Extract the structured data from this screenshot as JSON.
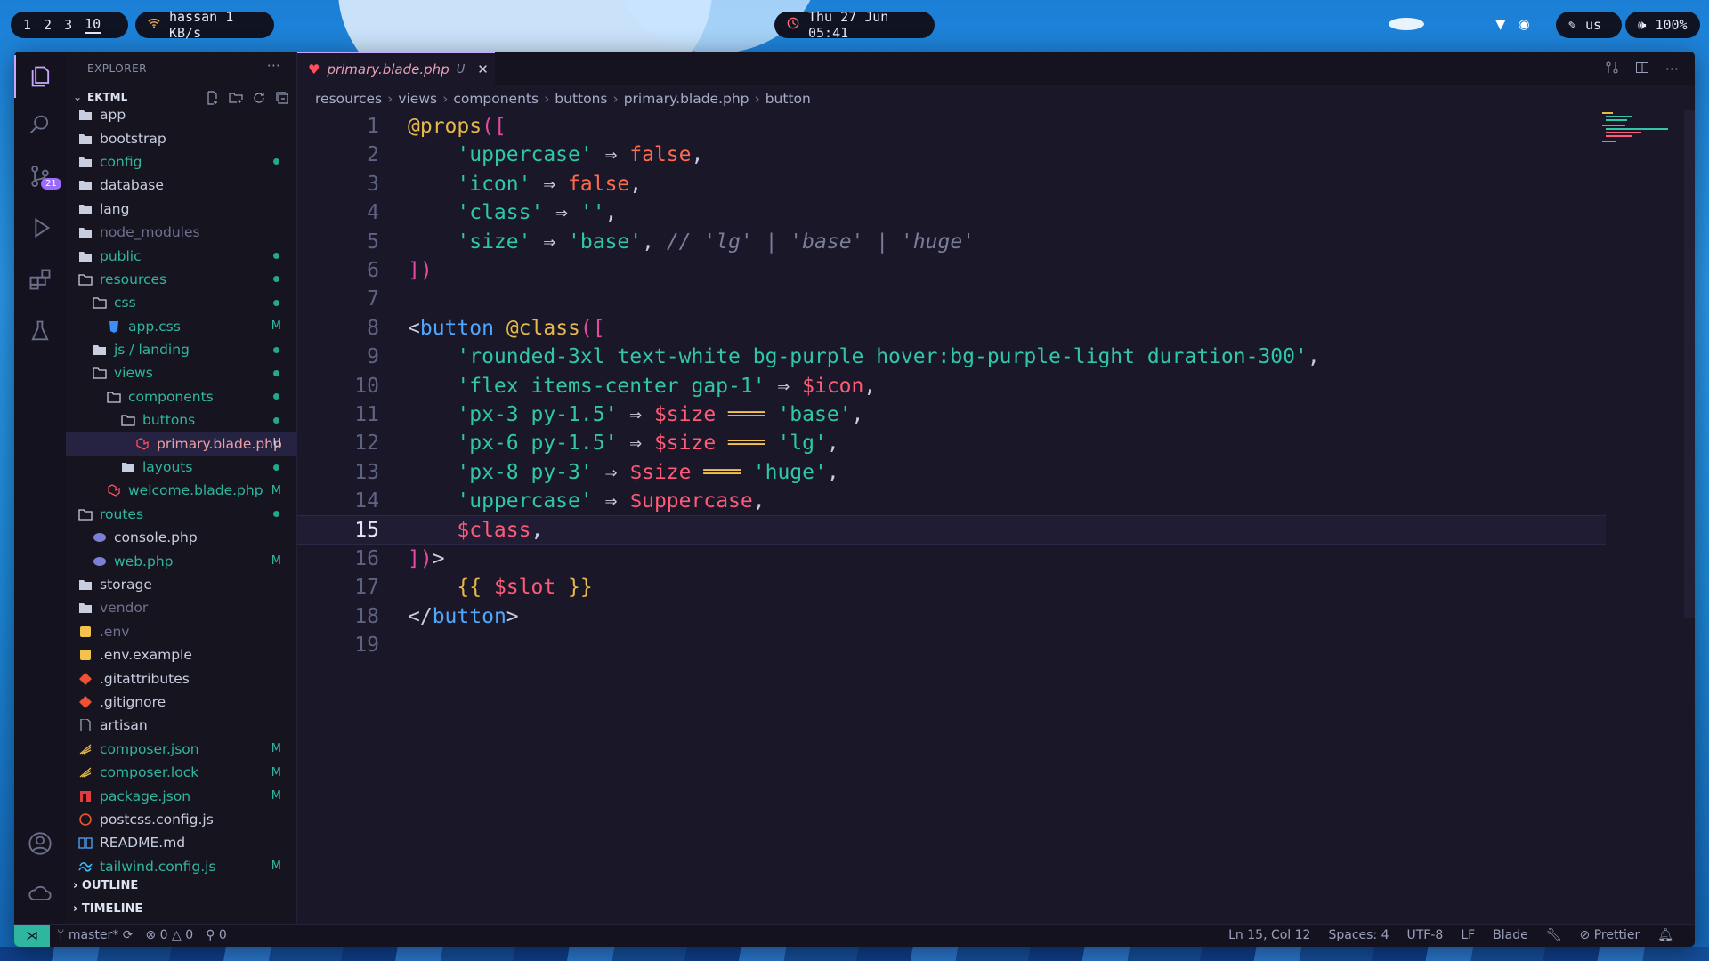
{
  "topbar": {
    "workspaces": [
      "1",
      "2",
      "3",
      "10"
    ],
    "network": "hassan 1 KB/s",
    "clock": "Thu 27 Jun 05:41",
    "keyboard": "us",
    "volume": "100%"
  },
  "explorer": {
    "title": "EXPLORER",
    "project": "EKTML",
    "tree": [
      {
        "label": "app",
        "icon": "folder-icon",
        "indent": 0,
        "status": "",
        "kind": "norm"
      },
      {
        "label": "bootstrap",
        "icon": "folder-icon",
        "indent": 0,
        "status": "",
        "kind": "norm"
      },
      {
        "label": "config",
        "icon": "folder-icon",
        "indent": 0,
        "status": "dot",
        "kind": "mod"
      },
      {
        "label": "database",
        "icon": "folder-icon",
        "indent": 0,
        "status": "",
        "kind": "norm"
      },
      {
        "label": "lang",
        "icon": "folder-icon",
        "indent": 0,
        "status": "",
        "kind": "norm"
      },
      {
        "label": "node_modules",
        "icon": "folder-icon",
        "indent": 0,
        "status": "",
        "kind": "dim"
      },
      {
        "label": "public",
        "icon": "folder-icon",
        "indent": 0,
        "status": "dot",
        "kind": "mod"
      },
      {
        "label": "resources",
        "icon": "folder-open-icon",
        "indent": 0,
        "status": "dot",
        "kind": "mod"
      },
      {
        "label": "css",
        "icon": "folder-open-icon",
        "indent": 1,
        "status": "dot",
        "kind": "mod"
      },
      {
        "label": "app.css",
        "icon": "css-file-icon",
        "indent": 2,
        "status": "M",
        "kind": "mod"
      },
      {
        "label": "js / landing",
        "icon": "folder-icon",
        "indent": 1,
        "status": "dot",
        "kind": "mod"
      },
      {
        "label": "views",
        "icon": "folder-open-icon",
        "indent": 1,
        "status": "dot",
        "kind": "mod"
      },
      {
        "label": "components",
        "icon": "folder-open-icon",
        "indent": 2,
        "status": "dot",
        "kind": "mod"
      },
      {
        "label": "buttons",
        "icon": "folder-open-icon",
        "indent": 3,
        "status": "dot",
        "kind": "mod"
      },
      {
        "label": "primary.blade.php",
        "icon": "blade-file-icon",
        "indent": 4,
        "status": "U",
        "kind": "sel"
      },
      {
        "label": "layouts",
        "icon": "folder-icon",
        "indent": 3,
        "status": "dot",
        "kind": "mod"
      },
      {
        "label": "welcome.blade.php",
        "icon": "blade-file-icon",
        "indent": 2,
        "status": "M",
        "kind": "mod"
      },
      {
        "label": "routes",
        "icon": "folder-open-icon",
        "indent": 0,
        "status": "dot",
        "kind": "mod"
      },
      {
        "label": "console.php",
        "icon": "php-file-icon",
        "indent": 1,
        "status": "",
        "kind": "norm"
      },
      {
        "label": "web.php",
        "icon": "php-file-icon",
        "indent": 1,
        "status": "M",
        "kind": "mod"
      },
      {
        "label": "storage",
        "icon": "folder-icon",
        "indent": 0,
        "status": "",
        "kind": "norm"
      },
      {
        "label": "vendor",
        "icon": "folder-icon",
        "indent": 0,
        "status": "",
        "kind": "dim"
      },
      {
        "label": ".env",
        "icon": "env-file-icon",
        "indent": 0,
        "status": "",
        "kind": "dim"
      },
      {
        "label": ".env.example",
        "icon": "env-file-icon",
        "indent": 0,
        "status": "",
        "kind": "norm"
      },
      {
        "label": ".gitattributes",
        "icon": "git-file-icon",
        "indent": 0,
        "status": "",
        "kind": "norm"
      },
      {
        "label": ".gitignore",
        "icon": "git-file-icon",
        "indent": 0,
        "status": "",
        "kind": "norm"
      },
      {
        "label": "artisan",
        "icon": "file-icon",
        "indent": 0,
        "status": "",
        "kind": "norm"
      },
      {
        "label": "composer.json",
        "icon": "composer-file-icon",
        "indent": 0,
        "status": "M",
        "kind": "mod"
      },
      {
        "label": "composer.lock",
        "icon": "composer-file-icon",
        "indent": 0,
        "status": "M",
        "kind": "mod"
      },
      {
        "label": "package.json",
        "icon": "npm-file-icon",
        "indent": 0,
        "status": "M",
        "kind": "mod"
      },
      {
        "label": "postcss.config.js",
        "icon": "postcss-file-icon",
        "indent": 0,
        "status": "",
        "kind": "norm"
      },
      {
        "label": "README.md",
        "icon": "readme-file-icon",
        "indent": 0,
        "status": "",
        "kind": "norm"
      },
      {
        "label": "tailwind.config.js",
        "icon": "tailwind-file-icon",
        "indent": 0,
        "status": "M",
        "kind": "mod"
      }
    ],
    "outline": "OUTLINE",
    "timeline": "TIMELINE"
  },
  "editor": {
    "tab_label": "primary.blade.php",
    "tab_status": "U",
    "breadcrumbs": [
      "resources",
      "views",
      "components",
      "buttons",
      "primary.blade.php",
      "button"
    ],
    "current_line": 15,
    "lines": [
      [
        [
          "@props",
          "dir"
        ],
        [
          "([",
          "br"
        ]
      ],
      [
        [
          "    ",
          "op"
        ],
        [
          "'uppercase'",
          "str"
        ],
        [
          " ⇒ ",
          "op"
        ],
        [
          "false",
          "bool"
        ],
        [
          ",",
          "op"
        ]
      ],
      [
        [
          "    ",
          "op"
        ],
        [
          "'icon'",
          "str"
        ],
        [
          " ⇒ ",
          "op"
        ],
        [
          "false",
          "bool"
        ],
        [
          ",",
          "op"
        ]
      ],
      [
        [
          "    ",
          "op"
        ],
        [
          "'class'",
          "str"
        ],
        [
          " ⇒ ",
          "op"
        ],
        [
          "''",
          "str"
        ],
        [
          ",",
          "op"
        ]
      ],
      [
        [
          "    ",
          "op"
        ],
        [
          "'size'",
          "str"
        ],
        [
          " ⇒ ",
          "op"
        ],
        [
          "'base'",
          "str"
        ],
        [
          ", ",
          "op"
        ],
        [
          "// 'lg' | 'base' | 'huge'",
          "com"
        ]
      ],
      [
        [
          "])",
          "br"
        ]
      ],
      [],
      [
        [
          "<",
          "op"
        ],
        [
          "button",
          "tag"
        ],
        [
          " ",
          "op"
        ],
        [
          "@class",
          "dir"
        ],
        [
          "([",
          "br"
        ]
      ],
      [
        [
          "    ",
          "op"
        ],
        [
          "'rounded-3xl text-white bg-purple hover:bg-purple-light duration-300'",
          "str"
        ],
        [
          ",",
          "op"
        ]
      ],
      [
        [
          "    ",
          "op"
        ],
        [
          "'flex items-center gap-1'",
          "str"
        ],
        [
          " ⇒ ",
          "op"
        ],
        [
          "$icon",
          "var"
        ],
        [
          ",",
          "op"
        ]
      ],
      [
        [
          "    ",
          "op"
        ],
        [
          "'px-3 py-1.5'",
          "str"
        ],
        [
          " ⇒ ",
          "op"
        ],
        [
          "$size",
          "var"
        ],
        [
          " ═══ ",
          "eq"
        ],
        [
          "'base'",
          "str"
        ],
        [
          ",",
          "op"
        ]
      ],
      [
        [
          "    ",
          "op"
        ],
        [
          "'px-6 py-1.5'",
          "str"
        ],
        [
          " ⇒ ",
          "op"
        ],
        [
          "$size",
          "var"
        ],
        [
          " ═══ ",
          "eq"
        ],
        [
          "'lg'",
          "str"
        ],
        [
          ",",
          "op"
        ]
      ],
      [
        [
          "    ",
          "op"
        ],
        [
          "'px-8 py-3'",
          "str"
        ],
        [
          " ⇒ ",
          "op"
        ],
        [
          "$size",
          "var"
        ],
        [
          " ═══ ",
          "eq"
        ],
        [
          "'huge'",
          "str"
        ],
        [
          ",",
          "op"
        ]
      ],
      [
        [
          "    ",
          "op"
        ],
        [
          "'uppercase'",
          "str"
        ],
        [
          " ⇒ ",
          "op"
        ],
        [
          "$uppercase",
          "var"
        ],
        [
          ",",
          "op"
        ]
      ],
      [
        [
          "    ",
          "op"
        ],
        [
          "$class",
          "var"
        ],
        [
          ",",
          "op"
        ]
      ],
      [
        [
          "])",
          "br"
        ],
        [
          ">",
          "op"
        ]
      ],
      [
        [
          "    ",
          "op"
        ],
        [
          "{{ ",
          "dir"
        ],
        [
          "$slot",
          "var"
        ],
        [
          " }}",
          "dir"
        ]
      ],
      [
        [
          "</",
          "op"
        ],
        [
          "button",
          "tag"
        ],
        [
          ">",
          "op"
        ]
      ],
      []
    ]
  },
  "statusbar": {
    "branch": "master*",
    "errors": "0",
    "warnings": "0",
    "ports": "0",
    "position": "Ln 15, Col 12",
    "spaces": "Spaces: 4",
    "encoding": "UTF-8",
    "eol": "LF",
    "language": "Blade",
    "formatter": "Prettier"
  },
  "colors": {
    "accent": "#c8a8ff",
    "modified": "#2fb6a0",
    "background": "#191728"
  }
}
